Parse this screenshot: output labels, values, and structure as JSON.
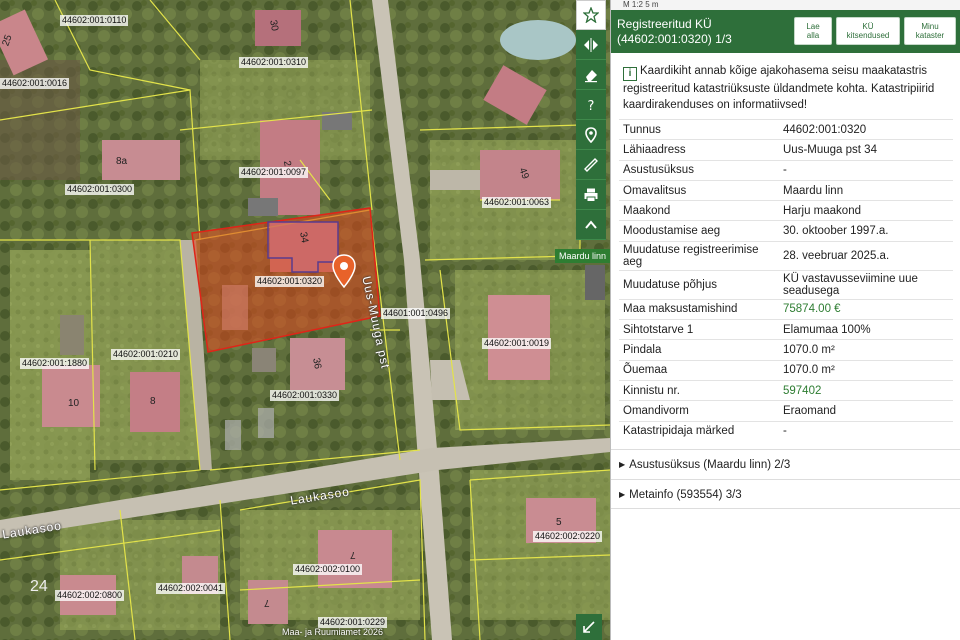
{
  "map": {
    "street_main": "Uus-Muuga pst",
    "street_lauka": "Laukasoo",
    "street_lauka2": "Laukasoo",
    "region_tag": "Maardu linn",
    "copyright": "Maa- ja Ruumiamet 2026",
    "parcel_labels": [
      "44602:001:0110",
      "44602:001:0016",
      "44602:001:0310",
      "44602:001:0300",
      "44602:001:0097",
      "44602:001:0063",
      "44602:001:0320",
      "44601:001:0496",
      "44602:001:1880",
      "44602:001:0210",
      "44602:001:0019",
      "44602:001:0330",
      "44602:002:0220",
      "44602:002:0100",
      "44602:002:0800",
      "44602:002:0041",
      "44602:001:0229"
    ],
    "house_numbers": [
      "25",
      "30",
      "8a",
      "2",
      "49",
      "34",
      "36",
      "10",
      "8",
      "5",
      "7",
      "7",
      "24"
    ]
  },
  "toolbar": {
    "items": [
      "star-icon",
      "split-icon",
      "eraser-icon",
      "help-icon",
      "location-icon",
      "ruler-icon",
      "print-icon",
      "collapse-icon"
    ]
  },
  "panel": {
    "scale": "M 1:2 5 m",
    "title_line1": "Registreeritud KÜ",
    "title_line2": "(44602:001:0320) 1/3",
    "btn_download_1": "Lae",
    "btn_download_2": "alla",
    "btn_restrictions_1": "KÜ",
    "btn_restrictions_2": "kitsendused",
    "btn_my_1": "Minu",
    "btn_my_2": "kataster",
    "info": "Kaardikiht annab kõige ajakohasema seisu maakatastris registreeritud katastriüksuste üldandmete kohta. Katastripiirid kaardirakenduses on informatiivsed!",
    "rows": [
      {
        "k": "Tunnus",
        "v": "44602:001:0320"
      },
      {
        "k": "Lähiaadress",
        "v": "Uus-Muuga pst 34"
      },
      {
        "k": "Asustusüksus",
        "v": "-"
      },
      {
        "k": "Omavalitsus",
        "v": "Maardu linn"
      },
      {
        "k": "Maakond",
        "v": "Harju maakond"
      },
      {
        "k": "Moodustamise aeg",
        "v": "30. oktoober 1997.a."
      },
      {
        "k": "Muudatuse registreerimise aeg",
        "v": "28. veebruar 2025.a."
      },
      {
        "k": "Muudatuse põhjus",
        "v": "KÜ vastavusseviimine uue seadusega"
      },
      {
        "k": "Maa maksustamishind",
        "v": "75874.00 €"
      },
      {
        "k": "Sihtotstarve 1",
        "v": "Elamumaa 100%"
      },
      {
        "k": "Pindala",
        "v": "1070.0 m²"
      },
      {
        "k": "Õuemaa",
        "v": "1070.0 m²"
      },
      {
        "k": "Kinnistu nr.",
        "v": "597402"
      },
      {
        "k": "Omandivorm",
        "v": "Eraomand"
      },
      {
        "k": "Katastripidaja märked",
        "v": "-"
      }
    ],
    "acc1": "Asustusüksus (Maardu linn) 2/3",
    "acc2": "Metainfo (593554) 3/3"
  }
}
